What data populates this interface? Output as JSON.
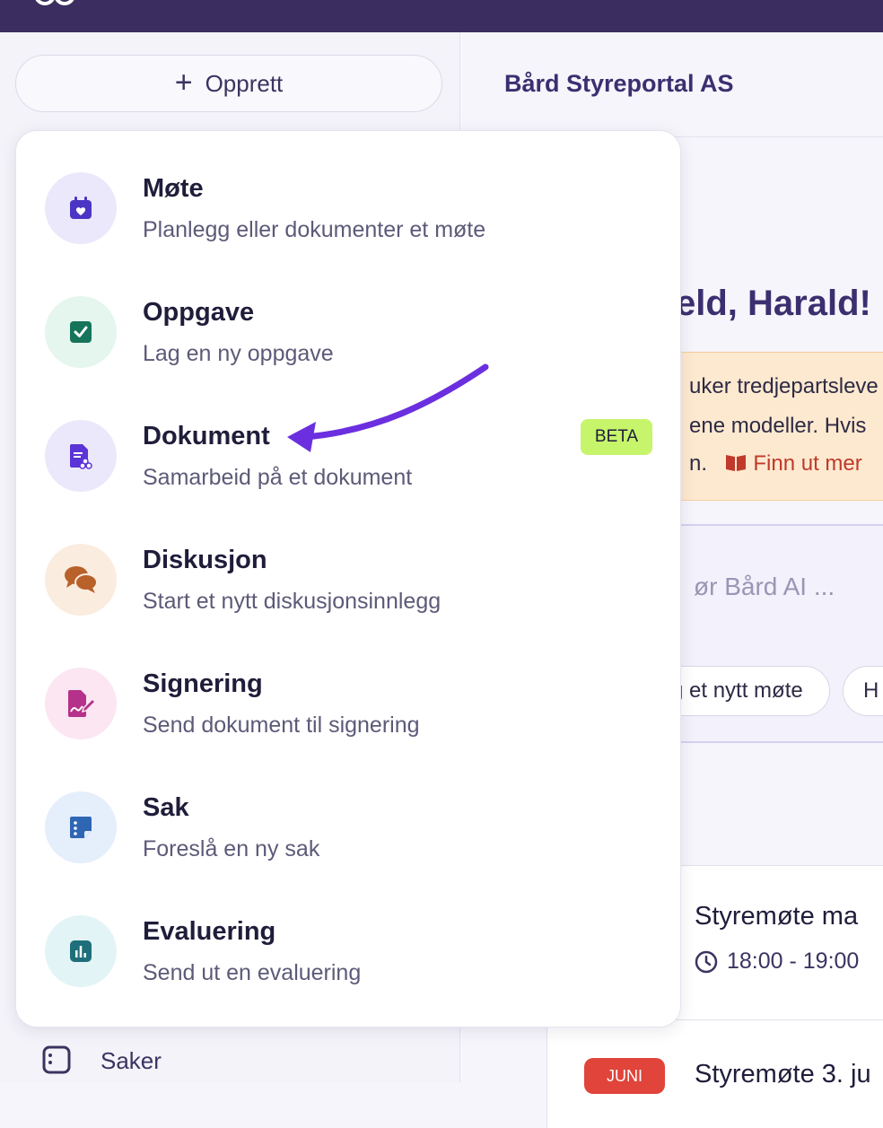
{
  "create_button": {
    "label": "Opprett",
    "icon": "plus-icon"
  },
  "header": {
    "org_name": "Bård Styreportal AS"
  },
  "greeting": "eld, Harald!",
  "notice": {
    "line1": "uker tredjepartsleve",
    "line2": "ene modeller. Hvis",
    "line3": "n.",
    "link": "Finn ut mer"
  },
  "ai_prompt": {
    "placeholder": "ør Bård AI ..."
  },
  "chips": [
    "g et nytt møte",
    "H"
  ],
  "sidebar": {
    "saker_label": "Saker"
  },
  "events": [
    {
      "title": "Styremøte ma",
      "time": "18:00 - 19:00"
    },
    {
      "month": "JUNI",
      "title": "Styremøte 3. ju"
    }
  ],
  "create_menu": {
    "items": [
      {
        "title": "Møte",
        "description": "Planlegg eller dokumenter et møte",
        "icon": "calendar-heart-icon",
        "bg": "#ece8fb",
        "fg": "#4a35c4"
      },
      {
        "title": "Oppgave",
        "description": "Lag en ny oppgave",
        "icon": "checkbox-icon",
        "bg": "#e4f6ee",
        "fg": "#16745a"
      },
      {
        "title": "Dokument",
        "description": "Samarbeid på et dokument",
        "icon": "document-icon",
        "bg": "#ece8fb",
        "fg": "#5b33d6",
        "badge": "BETA"
      },
      {
        "title": "Diskusjon",
        "description": "Start et nytt diskusjonsinnlegg",
        "icon": "chat-bubbles-icon",
        "bg": "#fbece0",
        "fg": "#b8612a"
      },
      {
        "title": "Signering",
        "description": "Send dokument til signering",
        "icon": "signature-icon",
        "bg": "#fbe6f1",
        "fg": "#b5318a"
      },
      {
        "title": "Sak",
        "description": "Foreslå en ny sak",
        "icon": "note-icon",
        "bg": "#e5eefb",
        "fg": "#2f66b4"
      },
      {
        "title": "Evaluering",
        "description": "Send ut en evaluering",
        "icon": "bar-chart-icon",
        "bg": "#e2f4f6",
        "fg": "#1f6f7a"
      }
    ]
  },
  "colors": {
    "topbar": "#3b2d5f",
    "accent": "#3c2f70",
    "beta": "#c6f56b",
    "arrow": "#6b2fe0"
  }
}
